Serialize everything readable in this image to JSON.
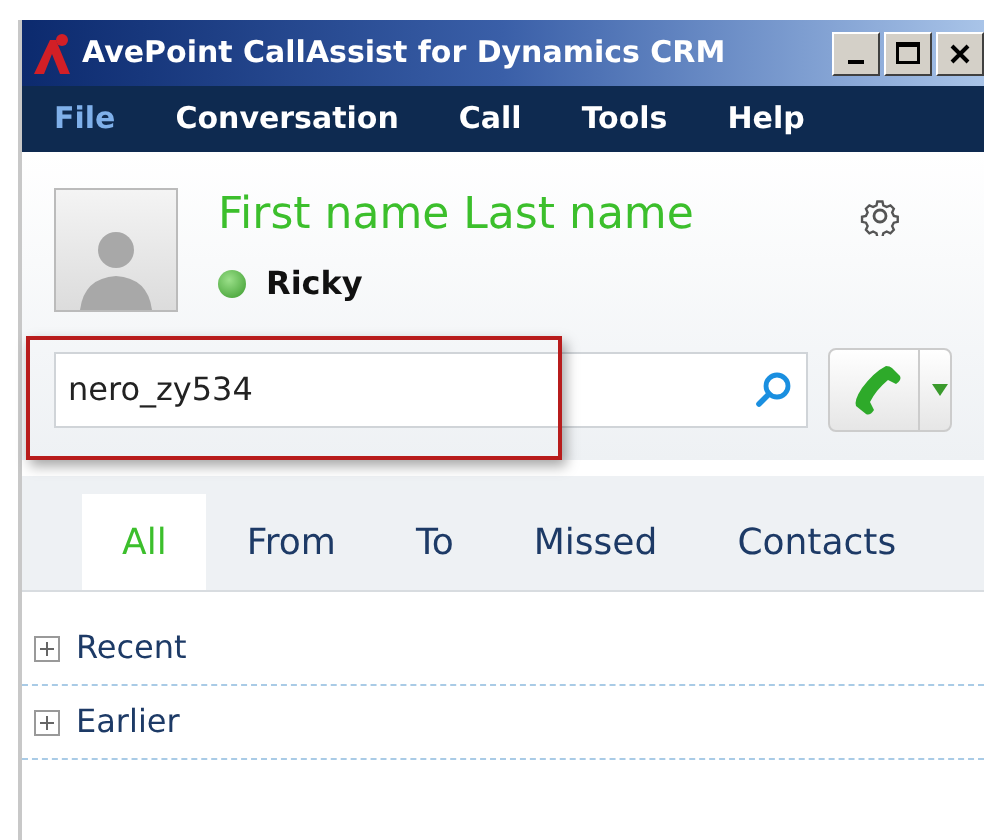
{
  "window": {
    "title": "AvePoint CallAssist for Dynamics CRM"
  },
  "menu": [
    {
      "label": "File",
      "selected": true
    },
    {
      "label": "Conversation",
      "selected": false
    },
    {
      "label": "Call",
      "selected": false
    },
    {
      "label": "Tools",
      "selected": false
    },
    {
      "label": "Help",
      "selected": false
    }
  ],
  "profile": {
    "name": "First name Last name",
    "status": "Ricky"
  },
  "search": {
    "value": "nero_zy534",
    "highlighted": true
  },
  "tabs": [
    {
      "label": "All",
      "selected": true
    },
    {
      "label": "From",
      "selected": false
    },
    {
      "label": "To",
      "selected": false
    },
    {
      "label": "Missed",
      "selected": false
    },
    {
      "label": "Contacts",
      "selected": false
    }
  ],
  "groups": [
    {
      "label": "Recent",
      "expanded": false
    },
    {
      "label": "Earlier",
      "expanded": false
    }
  ]
}
